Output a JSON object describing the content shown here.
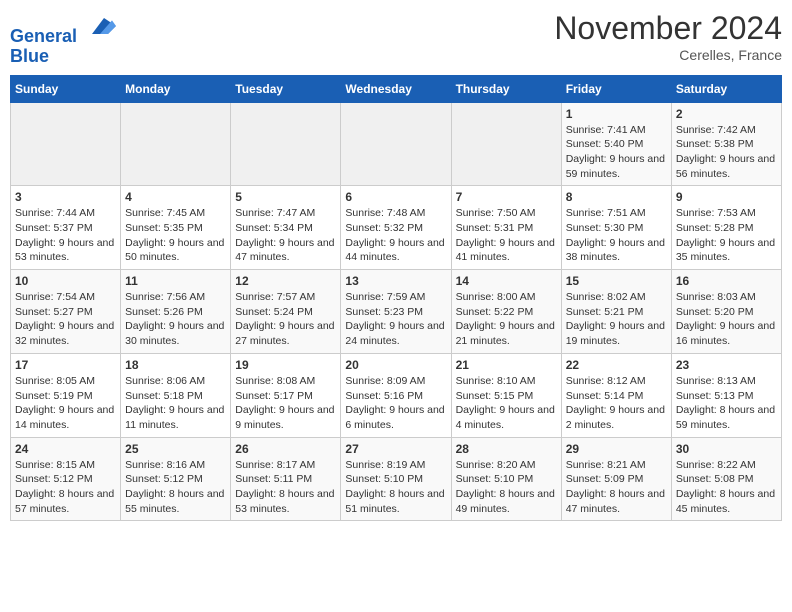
{
  "header": {
    "logo_line1": "General",
    "logo_line2": "Blue",
    "month": "November 2024",
    "location": "Cerelles, France"
  },
  "weekdays": [
    "Sunday",
    "Monday",
    "Tuesday",
    "Wednesday",
    "Thursday",
    "Friday",
    "Saturday"
  ],
  "weeks": [
    [
      {
        "day": "",
        "detail": ""
      },
      {
        "day": "",
        "detail": ""
      },
      {
        "day": "",
        "detail": ""
      },
      {
        "day": "",
        "detail": ""
      },
      {
        "day": "",
        "detail": ""
      },
      {
        "day": "1",
        "detail": "Sunrise: 7:41 AM\nSunset: 5:40 PM\nDaylight: 9 hours and 59 minutes."
      },
      {
        "day": "2",
        "detail": "Sunrise: 7:42 AM\nSunset: 5:38 PM\nDaylight: 9 hours and 56 minutes."
      }
    ],
    [
      {
        "day": "3",
        "detail": "Sunrise: 7:44 AM\nSunset: 5:37 PM\nDaylight: 9 hours and 53 minutes."
      },
      {
        "day": "4",
        "detail": "Sunrise: 7:45 AM\nSunset: 5:35 PM\nDaylight: 9 hours and 50 minutes."
      },
      {
        "day": "5",
        "detail": "Sunrise: 7:47 AM\nSunset: 5:34 PM\nDaylight: 9 hours and 47 minutes."
      },
      {
        "day": "6",
        "detail": "Sunrise: 7:48 AM\nSunset: 5:32 PM\nDaylight: 9 hours and 44 minutes."
      },
      {
        "day": "7",
        "detail": "Sunrise: 7:50 AM\nSunset: 5:31 PM\nDaylight: 9 hours and 41 minutes."
      },
      {
        "day": "8",
        "detail": "Sunrise: 7:51 AM\nSunset: 5:30 PM\nDaylight: 9 hours and 38 minutes."
      },
      {
        "day": "9",
        "detail": "Sunrise: 7:53 AM\nSunset: 5:28 PM\nDaylight: 9 hours and 35 minutes."
      }
    ],
    [
      {
        "day": "10",
        "detail": "Sunrise: 7:54 AM\nSunset: 5:27 PM\nDaylight: 9 hours and 32 minutes."
      },
      {
        "day": "11",
        "detail": "Sunrise: 7:56 AM\nSunset: 5:26 PM\nDaylight: 9 hours and 30 minutes."
      },
      {
        "day": "12",
        "detail": "Sunrise: 7:57 AM\nSunset: 5:24 PM\nDaylight: 9 hours and 27 minutes."
      },
      {
        "day": "13",
        "detail": "Sunrise: 7:59 AM\nSunset: 5:23 PM\nDaylight: 9 hours and 24 minutes."
      },
      {
        "day": "14",
        "detail": "Sunrise: 8:00 AM\nSunset: 5:22 PM\nDaylight: 9 hours and 21 minutes."
      },
      {
        "day": "15",
        "detail": "Sunrise: 8:02 AM\nSunset: 5:21 PM\nDaylight: 9 hours and 19 minutes."
      },
      {
        "day": "16",
        "detail": "Sunrise: 8:03 AM\nSunset: 5:20 PM\nDaylight: 9 hours and 16 minutes."
      }
    ],
    [
      {
        "day": "17",
        "detail": "Sunrise: 8:05 AM\nSunset: 5:19 PM\nDaylight: 9 hours and 14 minutes."
      },
      {
        "day": "18",
        "detail": "Sunrise: 8:06 AM\nSunset: 5:18 PM\nDaylight: 9 hours and 11 minutes."
      },
      {
        "day": "19",
        "detail": "Sunrise: 8:08 AM\nSunset: 5:17 PM\nDaylight: 9 hours and 9 minutes."
      },
      {
        "day": "20",
        "detail": "Sunrise: 8:09 AM\nSunset: 5:16 PM\nDaylight: 9 hours and 6 minutes."
      },
      {
        "day": "21",
        "detail": "Sunrise: 8:10 AM\nSunset: 5:15 PM\nDaylight: 9 hours and 4 minutes."
      },
      {
        "day": "22",
        "detail": "Sunrise: 8:12 AM\nSunset: 5:14 PM\nDaylight: 9 hours and 2 minutes."
      },
      {
        "day": "23",
        "detail": "Sunrise: 8:13 AM\nSunset: 5:13 PM\nDaylight: 8 hours and 59 minutes."
      }
    ],
    [
      {
        "day": "24",
        "detail": "Sunrise: 8:15 AM\nSunset: 5:12 PM\nDaylight: 8 hours and 57 minutes."
      },
      {
        "day": "25",
        "detail": "Sunrise: 8:16 AM\nSunset: 5:12 PM\nDaylight: 8 hours and 55 minutes."
      },
      {
        "day": "26",
        "detail": "Sunrise: 8:17 AM\nSunset: 5:11 PM\nDaylight: 8 hours and 53 minutes."
      },
      {
        "day": "27",
        "detail": "Sunrise: 8:19 AM\nSunset: 5:10 PM\nDaylight: 8 hours and 51 minutes."
      },
      {
        "day": "28",
        "detail": "Sunrise: 8:20 AM\nSunset: 5:10 PM\nDaylight: 8 hours and 49 minutes."
      },
      {
        "day": "29",
        "detail": "Sunrise: 8:21 AM\nSunset: 5:09 PM\nDaylight: 8 hours and 47 minutes."
      },
      {
        "day": "30",
        "detail": "Sunrise: 8:22 AM\nSunset: 5:08 PM\nDaylight: 8 hours and 45 minutes."
      }
    ]
  ]
}
